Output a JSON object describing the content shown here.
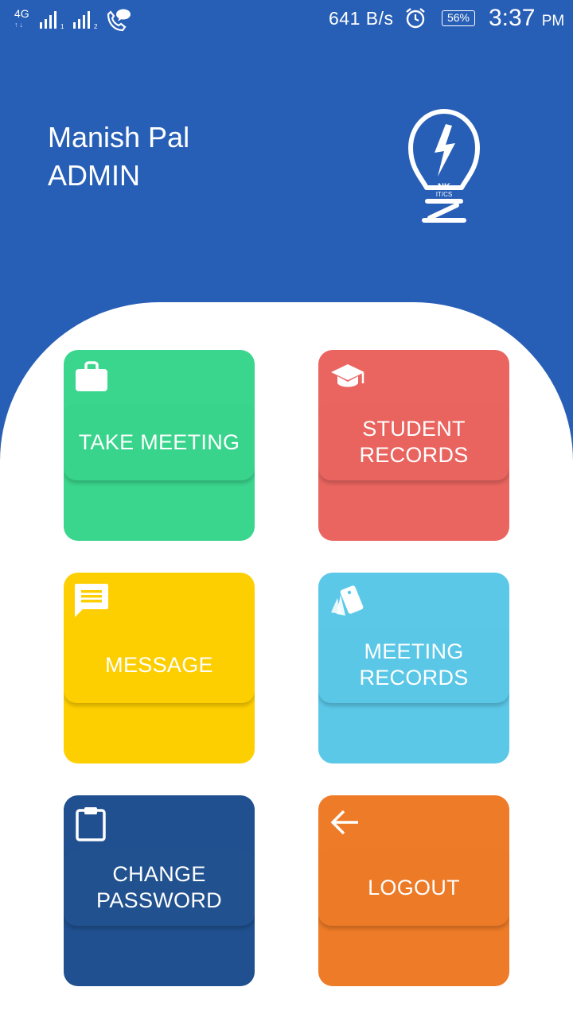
{
  "status_bar": {
    "network_type": "4G",
    "network_arrows": "↑↓",
    "sim1": "1",
    "sim2": "2",
    "data_speed": "641 B/s",
    "battery": "56%",
    "time": "3:37",
    "ampm": "PM"
  },
  "profile": {
    "name": "Manish Pal",
    "role": "ADMIN",
    "logo_icon": "bulb-logo-icon",
    "logo_text_top": "NK",
    "logo_text_bottom": "IT/CS"
  },
  "tiles": [
    {
      "label": "TAKE MEETING",
      "icon": "briefcase-icon",
      "color": "#3ad68d",
      "band": "#39d48c"
    },
    {
      "label": "STUDENT\nRECORDS",
      "icon": "graduation-cap-icon",
      "color": "#ea6560",
      "band": "#e9645f"
    },
    {
      "label": "MESSAGE",
      "icon": "message-icon",
      "color": "#fecf00",
      "band": "#fdce00"
    },
    {
      "label": "MEETING\nRECORDS",
      "icon": "cards-icon",
      "color": "#5bc8e8",
      "band": "#5ac7e7"
    },
    {
      "label": "CHANGE\nPASSWORD",
      "icon": "clipboard-icon",
      "color": "#20508f",
      "band": "#21528f"
    },
    {
      "label": "LOGOUT",
      "icon": "back-arrow-icon",
      "color": "#ee7b27",
      "band": "#ed7a26"
    }
  ]
}
